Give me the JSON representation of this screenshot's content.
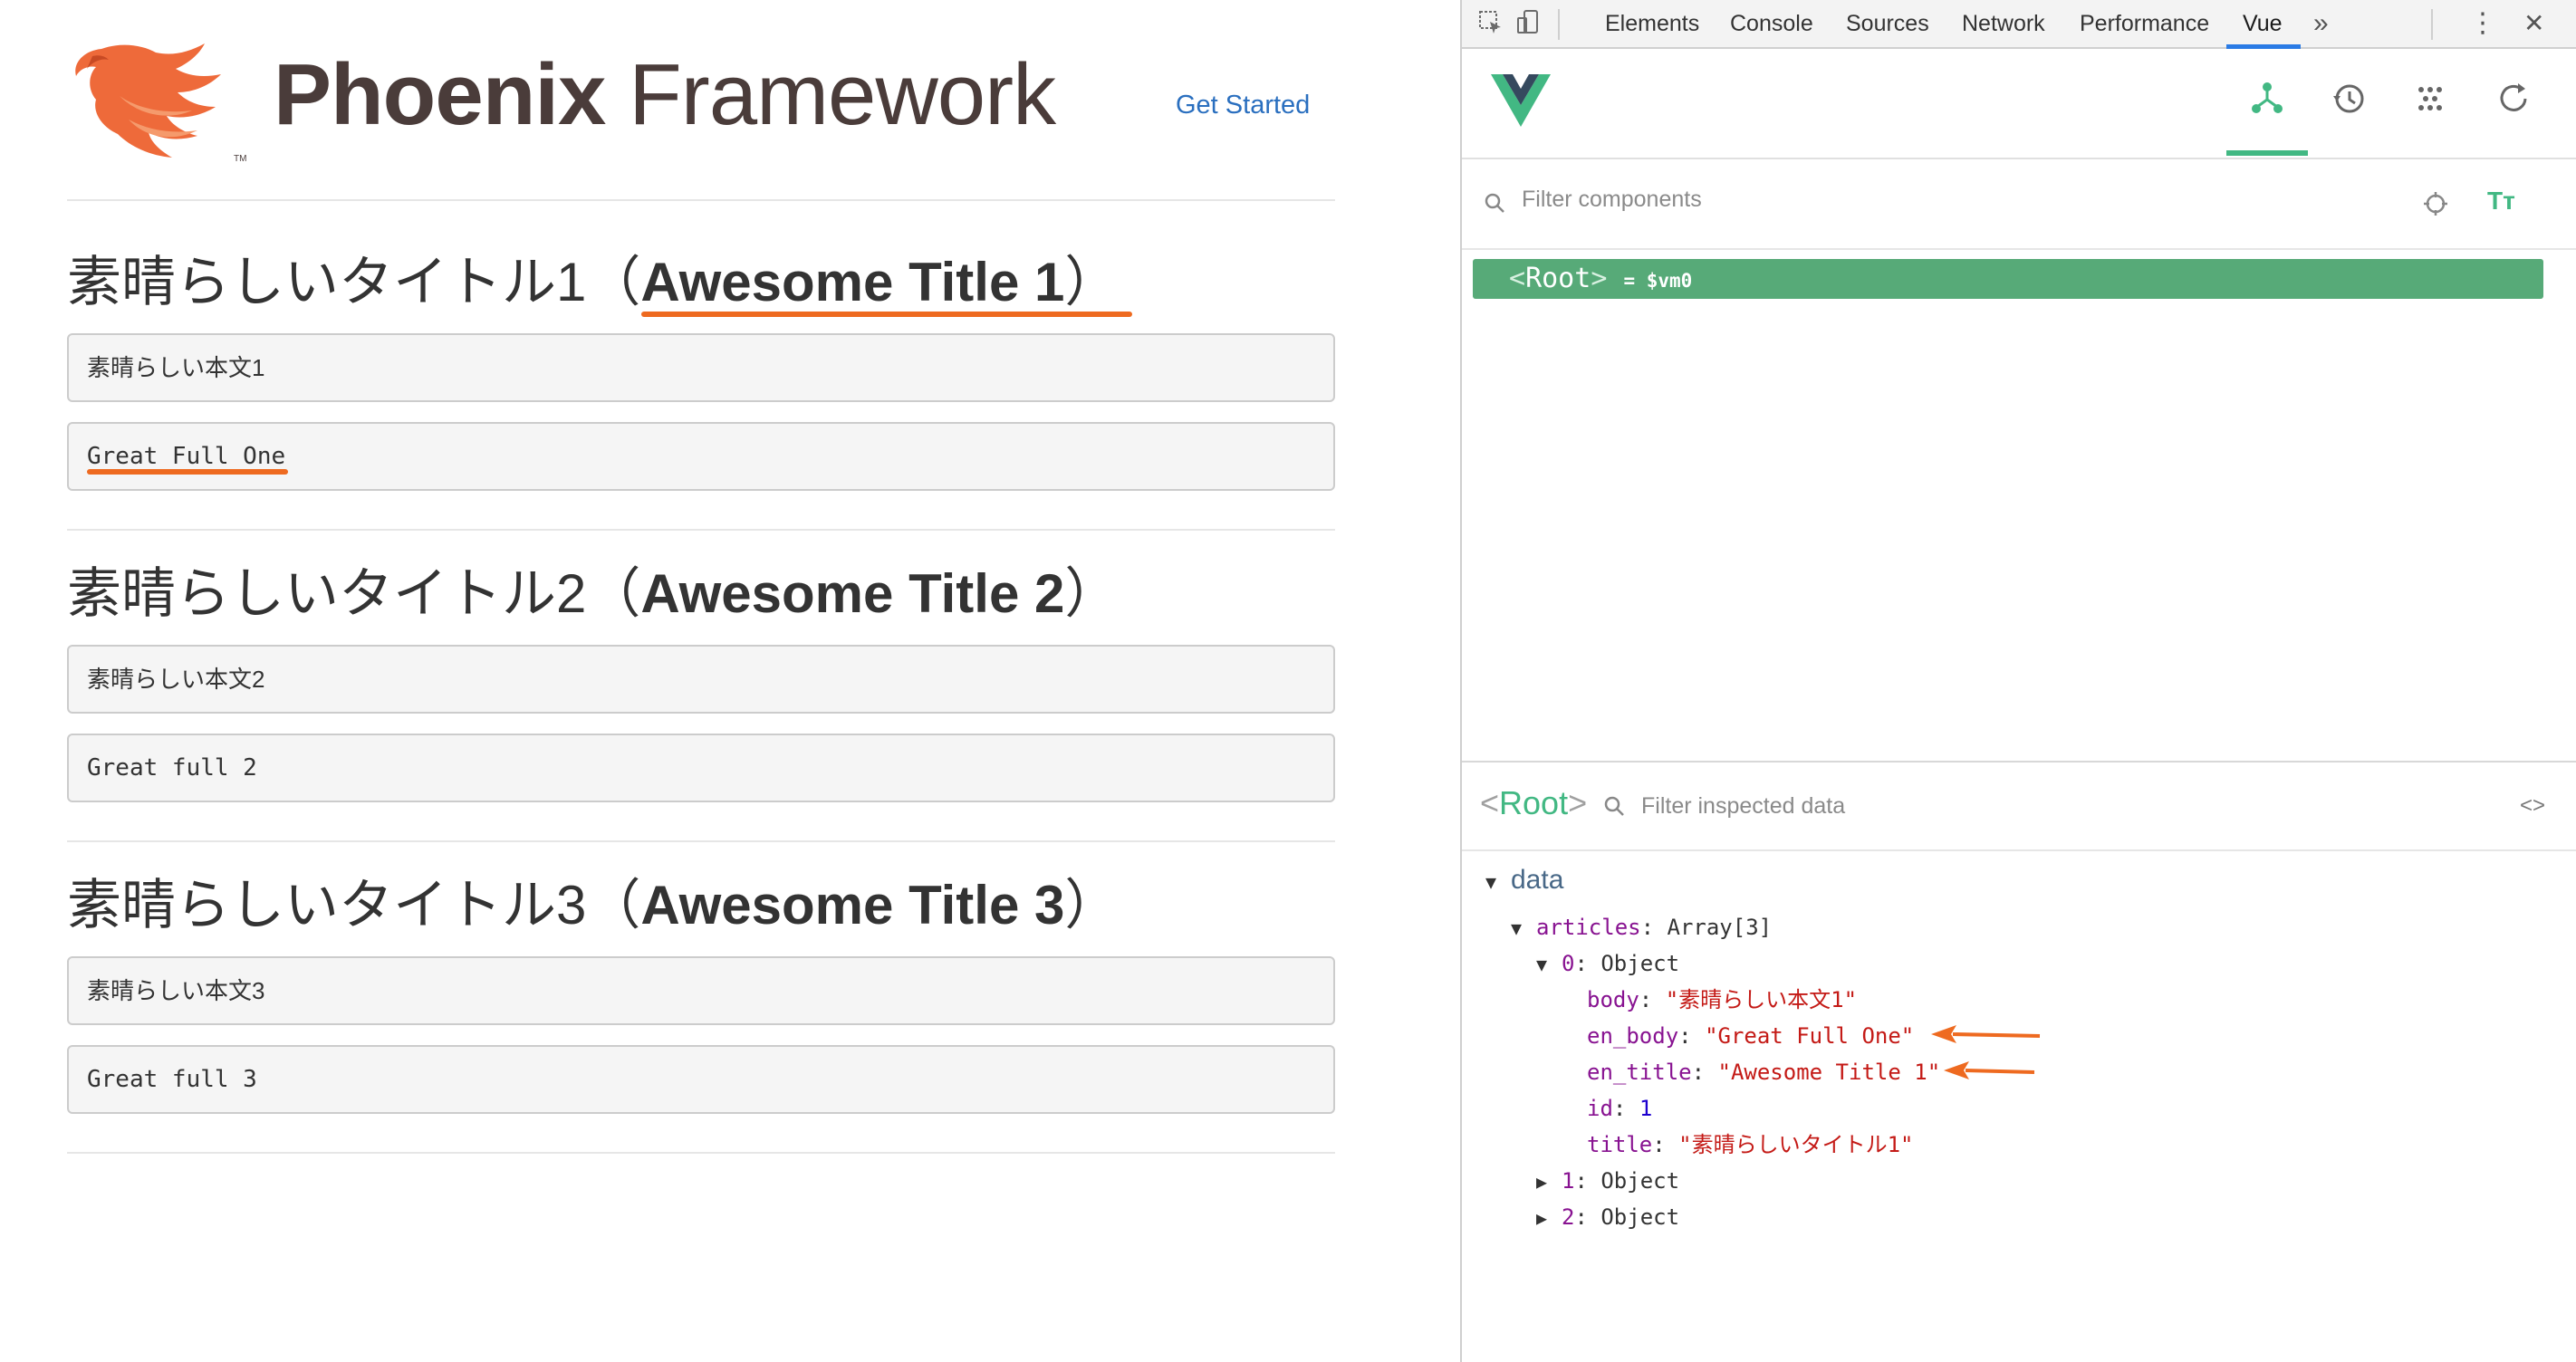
{
  "page": {
    "logo": {
      "bold": "Phoenix",
      "light": "Framework"
    },
    "nav_link": "Get Started",
    "articles": [
      {
        "title_ja": "素晴らしいタイトル1（",
        "title_en": "Awesome Title 1",
        "title_close": "）",
        "body": "素晴らしい本文1",
        "en_body": "Great Full One"
      },
      {
        "title_ja": "素晴らしいタイトル2（",
        "title_en": "Awesome Title 2",
        "title_close": "）",
        "body": "素晴らしい本文2",
        "en_body": "Great full 2"
      },
      {
        "title_ja": "素晴らしいタイトル3（",
        "title_en": "Awesome Title 3",
        "title_close": "）",
        "body": "素晴らしい本文3",
        "en_body": "Great full 3"
      }
    ]
  },
  "devtools": {
    "tabs": [
      "Elements",
      "Console",
      "Sources",
      "Network",
      "Performance",
      "Vue"
    ],
    "active_tab": "Vue",
    "more": "»",
    "menu": "⋮",
    "close": "✕",
    "filter_components_placeholder": "Filter components",
    "root_component": {
      "name": "Root",
      "ref": "= $vm0"
    },
    "inspector": {
      "component": "Root",
      "filter_placeholder": "Filter inspected data",
      "code_toggle": "<>",
      "section": "data",
      "articles_key": "articles",
      "articles_value": "Array[3]",
      "object_label": "Object",
      "expanded_index": "0",
      "fields": [
        {
          "key": "body",
          "value": "\"素晴らしい本文1\"",
          "type": "string"
        },
        {
          "key": "en_body",
          "value": "\"Great Full One\"",
          "type": "string"
        },
        {
          "key": "en_title",
          "value": "\"Awesome Title 1\"",
          "type": "string"
        },
        {
          "key": "id",
          "value": "1",
          "type": "number"
        },
        {
          "key": "title",
          "value": "\"素晴らしいタイトル1\"",
          "type": "string"
        }
      ],
      "collapsed": [
        "1",
        "2"
      ]
    },
    "colors": {
      "vue_green": "#42b883",
      "row_green": "#57aa78",
      "tab_blue": "#2a7be5",
      "annotation_orange": "#ee6a20"
    }
  }
}
